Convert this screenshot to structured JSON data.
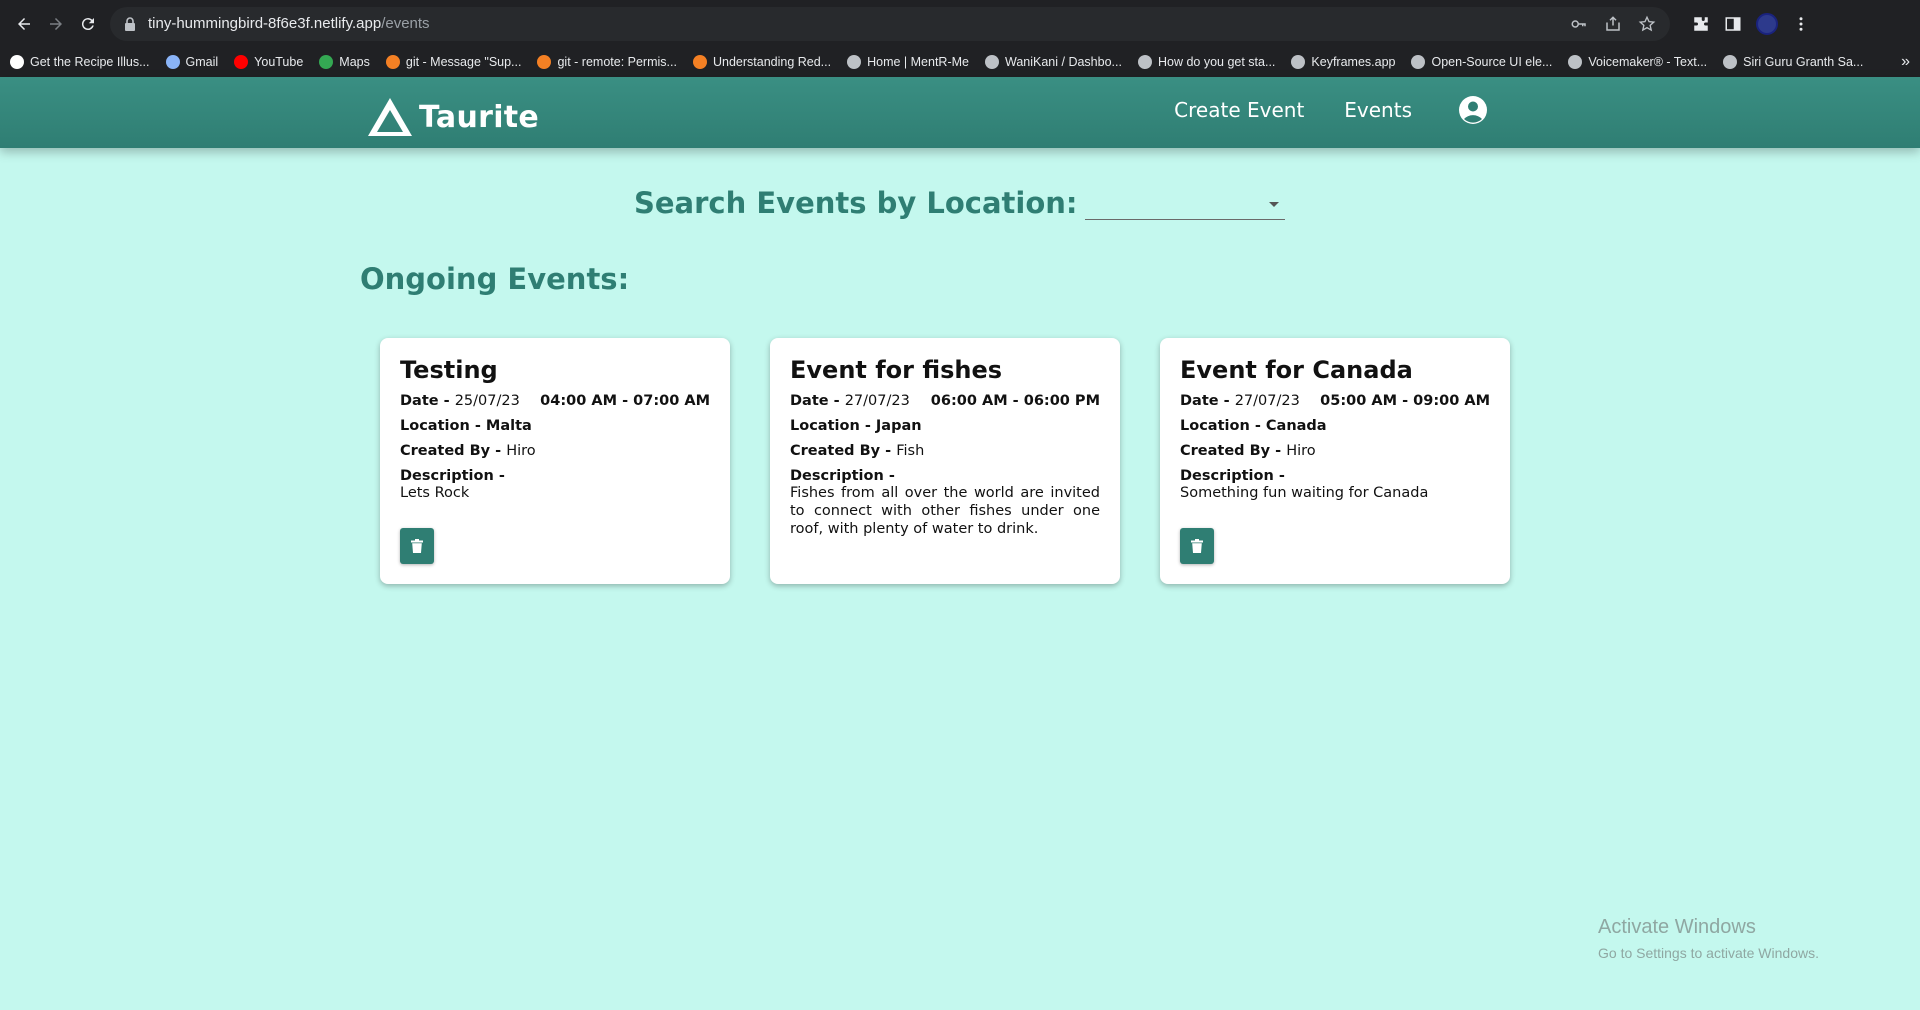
{
  "browser": {
    "url_host": "tiny-hummingbird-8f6e3f.netlify.app",
    "url_path": "/events",
    "bookmarks": [
      {
        "label": "Get the Recipe Illus...",
        "color": "#ffffff"
      },
      {
        "label": "Gmail",
        "color": "#8ab4f8"
      },
      {
        "label": "YouTube",
        "color": "#ff0000"
      },
      {
        "label": "Maps",
        "color": "#34a853"
      },
      {
        "label": "git - Message \"Sup...",
        "color": "#f48024"
      },
      {
        "label": "git - remote: Permis...",
        "color": "#f48024"
      },
      {
        "label": "Understanding Red...",
        "color": "#f48024"
      },
      {
        "label": "Home | MentR-Me",
        "color": "#bdc1c6"
      },
      {
        "label": "WaniKani / Dashbo...",
        "color": "#bdc1c6"
      },
      {
        "label": "How do you get sta...",
        "color": "#bdc1c6"
      },
      {
        "label": "Keyframes.app",
        "color": "#bdc1c6"
      },
      {
        "label": "Open-Source UI ele...",
        "color": "#bdc1c6"
      },
      {
        "label": "Voicemaker® - Text...",
        "color": "#bdc1c6"
      },
      {
        "label": "Siri Guru Granth Sa...",
        "color": "#bdc1c6"
      }
    ]
  },
  "header": {
    "brand": "Taurite",
    "nav": {
      "create": "Create Event",
      "events": "Events"
    }
  },
  "search": {
    "label": "Search Events by Location:",
    "selected": ""
  },
  "section_title": "Ongoing Events:",
  "labels": {
    "date": "Date - ",
    "location": "Location - ",
    "created_by": "Created By - ",
    "description": "Description -"
  },
  "events": [
    {
      "title": "Testing",
      "date": "25/07/23",
      "time": "04:00 AM - 07:00 AM",
      "location": "Malta",
      "created_by": "Hiro",
      "description": "Lets Rock",
      "deletable": true
    },
    {
      "title": "Event for fishes",
      "date": "27/07/23",
      "time": "06:00 AM - 06:00 PM",
      "location": "Japan",
      "created_by": "Fish",
      "description": "Fishes from all over the world are invited to connect with other fishes under one roof, with plenty of water to drink.",
      "deletable": false
    },
    {
      "title": "Event for Canada",
      "date": "27/07/23",
      "time": "05:00 AM - 09:00 AM",
      "location": "Canada",
      "created_by": "Hiro",
      "description": "Something fun waiting for Canada",
      "deletable": true
    }
  ],
  "watermark": {
    "title": "Activate Windows",
    "subtitle": "Go to Settings to activate Windows."
  },
  "colors": {
    "page_bg": "#c4f8ee",
    "accent": "#2f7e73"
  }
}
